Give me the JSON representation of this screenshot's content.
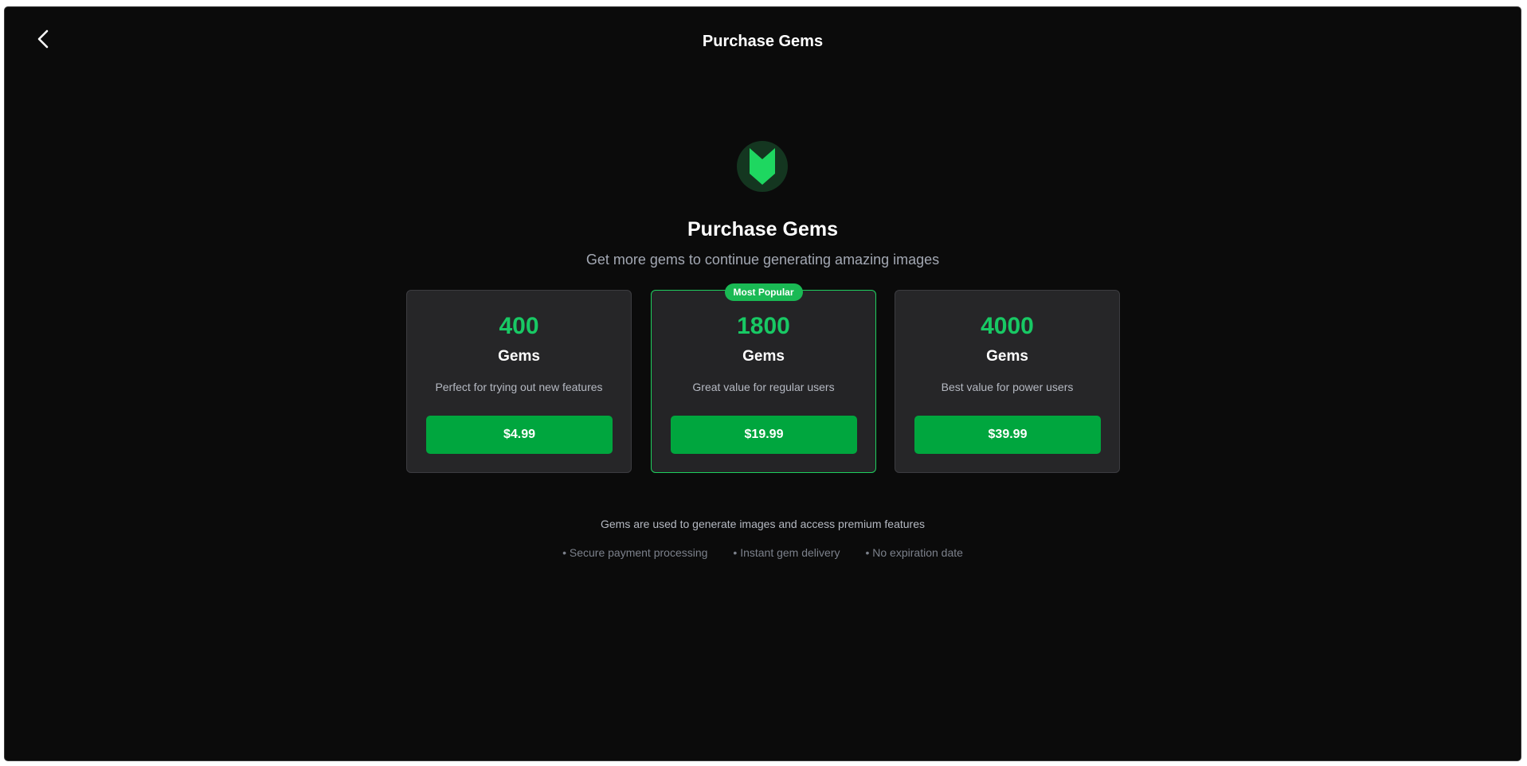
{
  "header": {
    "back_icon": "chevron-left-icon",
    "title": "Purchase Gems"
  },
  "hero": {
    "logo_icon": "gem-chevron-logo",
    "title": "Purchase Gems",
    "subtitle": "Get more gems to continue generating amazing images"
  },
  "packages": [
    {
      "amount": "400",
      "unit": "Gems",
      "description": "Perfect for trying out new features",
      "price": "$4.99"
    },
    {
      "amount": "1800",
      "unit": "Gems",
      "description": "Great value for regular users",
      "price": "$19.99",
      "badge": "Most Popular"
    },
    {
      "amount": "4000",
      "unit": "Gems",
      "description": "Best value for power users",
      "price": "$39.99"
    }
  ],
  "footer": {
    "note": "Gems are used to generate images and access premium features",
    "features": [
      "• Secure payment processing",
      "• Instant gem delivery",
      "• No expiration date"
    ]
  },
  "colors": {
    "background": "#0b0b0b",
    "card": "#262628",
    "accent": "#18c964",
    "button": "#00a63e",
    "popular_border": "#1fcf5e"
  }
}
